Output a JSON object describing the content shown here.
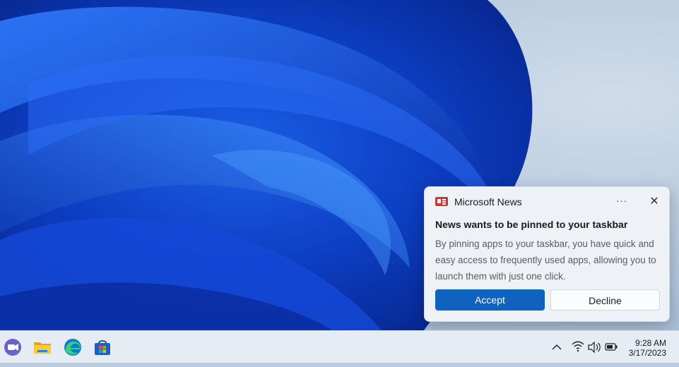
{
  "toast": {
    "app_name": "Microsoft News",
    "more_label": "···",
    "close_label": "✕",
    "title": "News wants to be pinned to your taskbar",
    "body": "By pinning apps to your taskbar, you have quick and easy access to frequently used apps, allowing you to launch them with just one click.",
    "accept_label": "Accept",
    "decline_label": "Decline"
  },
  "taskbar": {
    "apps": [
      {
        "name": "teams-chat-icon"
      },
      {
        "name": "file-explorer-icon"
      },
      {
        "name": "edge-icon"
      },
      {
        "name": "microsoft-store-icon"
      }
    ],
    "tray": {
      "chevron": "^",
      "time": "9:28 AM",
      "date": "3/17/2023"
    }
  },
  "colors": {
    "accent": "#0f62be",
    "news_red": "#d13438"
  }
}
